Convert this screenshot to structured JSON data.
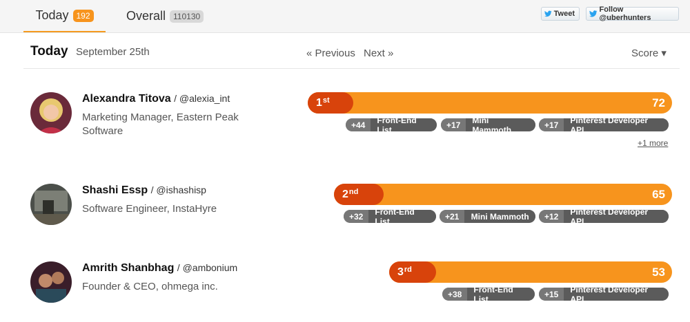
{
  "tabs": {
    "today": {
      "label": "Today",
      "count": "192"
    },
    "overall": {
      "label": "Overall",
      "count": "110130"
    }
  },
  "social": {
    "tweet": "Tweet",
    "follow": "Follow @uberhunters"
  },
  "header": {
    "title": "Today",
    "date": "September 25th",
    "previous": "« Previous",
    "next": "Next »",
    "sort": "Score ▾"
  },
  "entries": [
    {
      "name": "Alexandra Titova",
      "handle": "/ @alexia_int",
      "role": "Marketing Manager, Eastern Peak Software",
      "rank": "1",
      "rank_suffix": "st",
      "score": "72",
      "tags": [
        {
          "points": "+44",
          "name": "Front-End List"
        },
        {
          "points": "+17",
          "name": "Mini Mammoth"
        },
        {
          "points": "+17",
          "name": "Pinterest Developer API"
        }
      ],
      "more": "+1 more"
    },
    {
      "name": "Shashi Essp",
      "handle": "/ @ishashisp",
      "role": "Software Engineer, InstaHyre",
      "rank": "2",
      "rank_suffix": "nd",
      "score": "65",
      "tags": [
        {
          "points": "+32",
          "name": "Front-End List"
        },
        {
          "points": "+21",
          "name": "Mini Mammoth"
        },
        {
          "points": "+12",
          "name": "Pinterest Developer API"
        }
      ]
    },
    {
      "name": "Amrith Shanbhag",
      "handle": "/ @ambonium",
      "role": "Founder & CEO, ohmega inc.",
      "rank": "3",
      "rank_suffix": "rd",
      "score": "53",
      "tags": [
        {
          "points": "+38",
          "name": "Front-End List"
        },
        {
          "points": "+15",
          "name": "Pinterest Developer API"
        }
      ]
    }
  ],
  "colors": {
    "bar": "#f7941d",
    "rank": "#d8430b",
    "tag": "#5b5b5b",
    "accent": "#f59a1e"
  }
}
